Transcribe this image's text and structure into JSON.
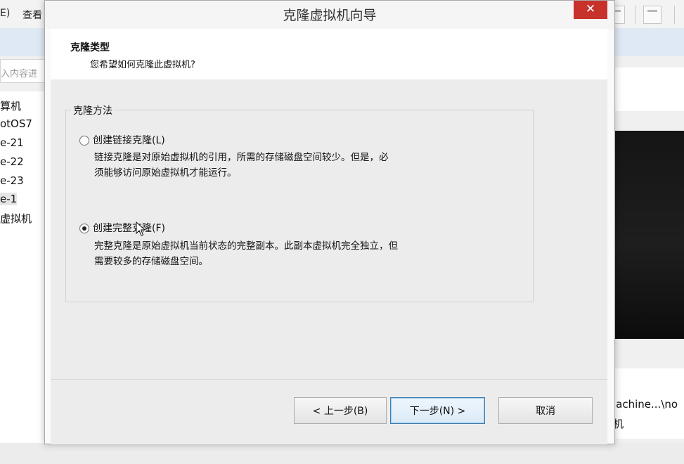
{
  "background_app": {
    "menu": [
      "E)",
      "查看"
    ],
    "search_placeholder": "入内容进",
    "tree_items": [
      "算机",
      "otOS7",
      "e-21",
      "e-22",
      "e-23",
      "e-1",
      "虚拟机"
    ],
    "selected_tree_index": 5,
    "right_text_line1": "lachine...\\no",
    "right_text_line2": "机"
  },
  "dialog": {
    "title": "克隆虚拟机向导",
    "close_label": "✕",
    "header": {
      "title": "克隆类型",
      "subtitle": "您希望如何克隆此虚拟机?"
    },
    "group_label": "克隆方法",
    "options": [
      {
        "label": "创建链接克隆(L)",
        "desc_line1": "链接克隆是对原始虚拟机的引用，所需的存储磁盘空间较少。但是，必",
        "desc_line2": "须能够访问原始虚拟机才能运行。",
        "checked": false
      },
      {
        "label": "创建完整克隆(F)",
        "desc_line1": "完整克隆是原始虚拟机当前状态的完整副本。此副本虚拟机完全独立，但",
        "desc_line2": "需要较多的存储磁盘空间。",
        "checked": true
      }
    ],
    "buttons": {
      "back": "< 上一步(B)",
      "next": "下一步(N) >",
      "cancel": "取消"
    }
  },
  "colors": {
    "close_button": "#c7322b",
    "default_button_border": "#3c7fb1"
  }
}
